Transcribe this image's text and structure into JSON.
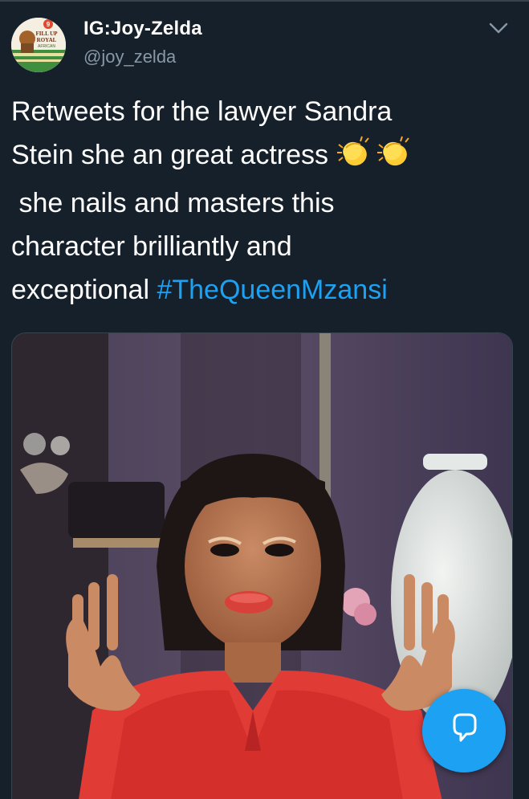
{
  "author": {
    "name": "IG:Joy-Zelda",
    "handle": "@joy_zelda",
    "avatar_text": [
      "9",
      "FILL UP",
      "ROYAL",
      "AFRICAN"
    ]
  },
  "menu": {
    "icon": "chevron-down-icon"
  },
  "tweet": {
    "line1": "Retweets for the lawyer Sandra",
    "line2": "Stein she an great actress",
    "line3": " she nails and masters this",
    "line4": "character brilliantly and",
    "line5_text": "exceptional ",
    "hashtag": "#TheQueenMzansi",
    "emoji": "clapping-hands-icon"
  },
  "media": {
    "type": "photo",
    "description_icon": "photo-of-woman-in-red-dress"
  },
  "fab": {
    "icon": "reply-bubble-icon"
  },
  "colors": {
    "background": "#15202b",
    "text": "#ffffff",
    "secondary_text": "#8899a6",
    "link": "#1da1f2",
    "fab": "#1da1f2",
    "border": "#38444d"
  }
}
